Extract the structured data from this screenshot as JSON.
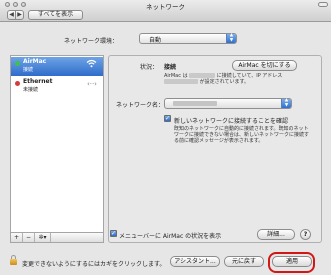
{
  "window": {
    "title": "ネットワーク",
    "show_all_label": "すべてを表示",
    "nav_back": "◀",
    "nav_forward": "▶"
  },
  "location": {
    "label": "ネットワーク環境：",
    "value": "自動"
  },
  "sidebar": {
    "services": [
      {
        "name": "AirMac",
        "status": "接続",
        "icon": "wifi-icon",
        "status_color": "#3fc24a"
      },
      {
        "name": "Ethernet",
        "status": "未接続",
        "icon": "ethernet-arrows-icon",
        "status_color": "#d63a3a"
      }
    ],
    "add_label": "+",
    "remove_label": "−",
    "action_label": "✲▾"
  },
  "detail": {
    "status_label": "状況：",
    "status_value": "接続",
    "turn_off_button": "AirMac を切にする",
    "status_desc_line1a": "AirMac は",
    "status_desc_line1b": "に接続していて、IP アドレス",
    "status_desc_line2b": "が設定されています。",
    "network_name_label": "ネットワーク名：",
    "ask_join_label": "新しいネットワークに接続することを確認",
    "ask_join_desc_1": "既知のネットワークに自動的に接続されます。既知のネット",
    "ask_join_desc_2": "ワークに接続できない場合は、新しいネットワークに接続す",
    "ask_join_desc_3": "る前に確認メッセージが表示されます。",
    "show_menu_label": "メニューバーに AirMac の状況を表示",
    "advanced_button": "詳細...",
    "help_button": "?"
  },
  "footer": {
    "lock_text": "変更できないようにするにはカギをクリックします。",
    "assistant_button": "アシスタント...",
    "revert_button": "元に戻す",
    "apply_button": "適用"
  },
  "colors": {
    "selection": "#3a77d4",
    "highlight_ring": "#d01818"
  }
}
